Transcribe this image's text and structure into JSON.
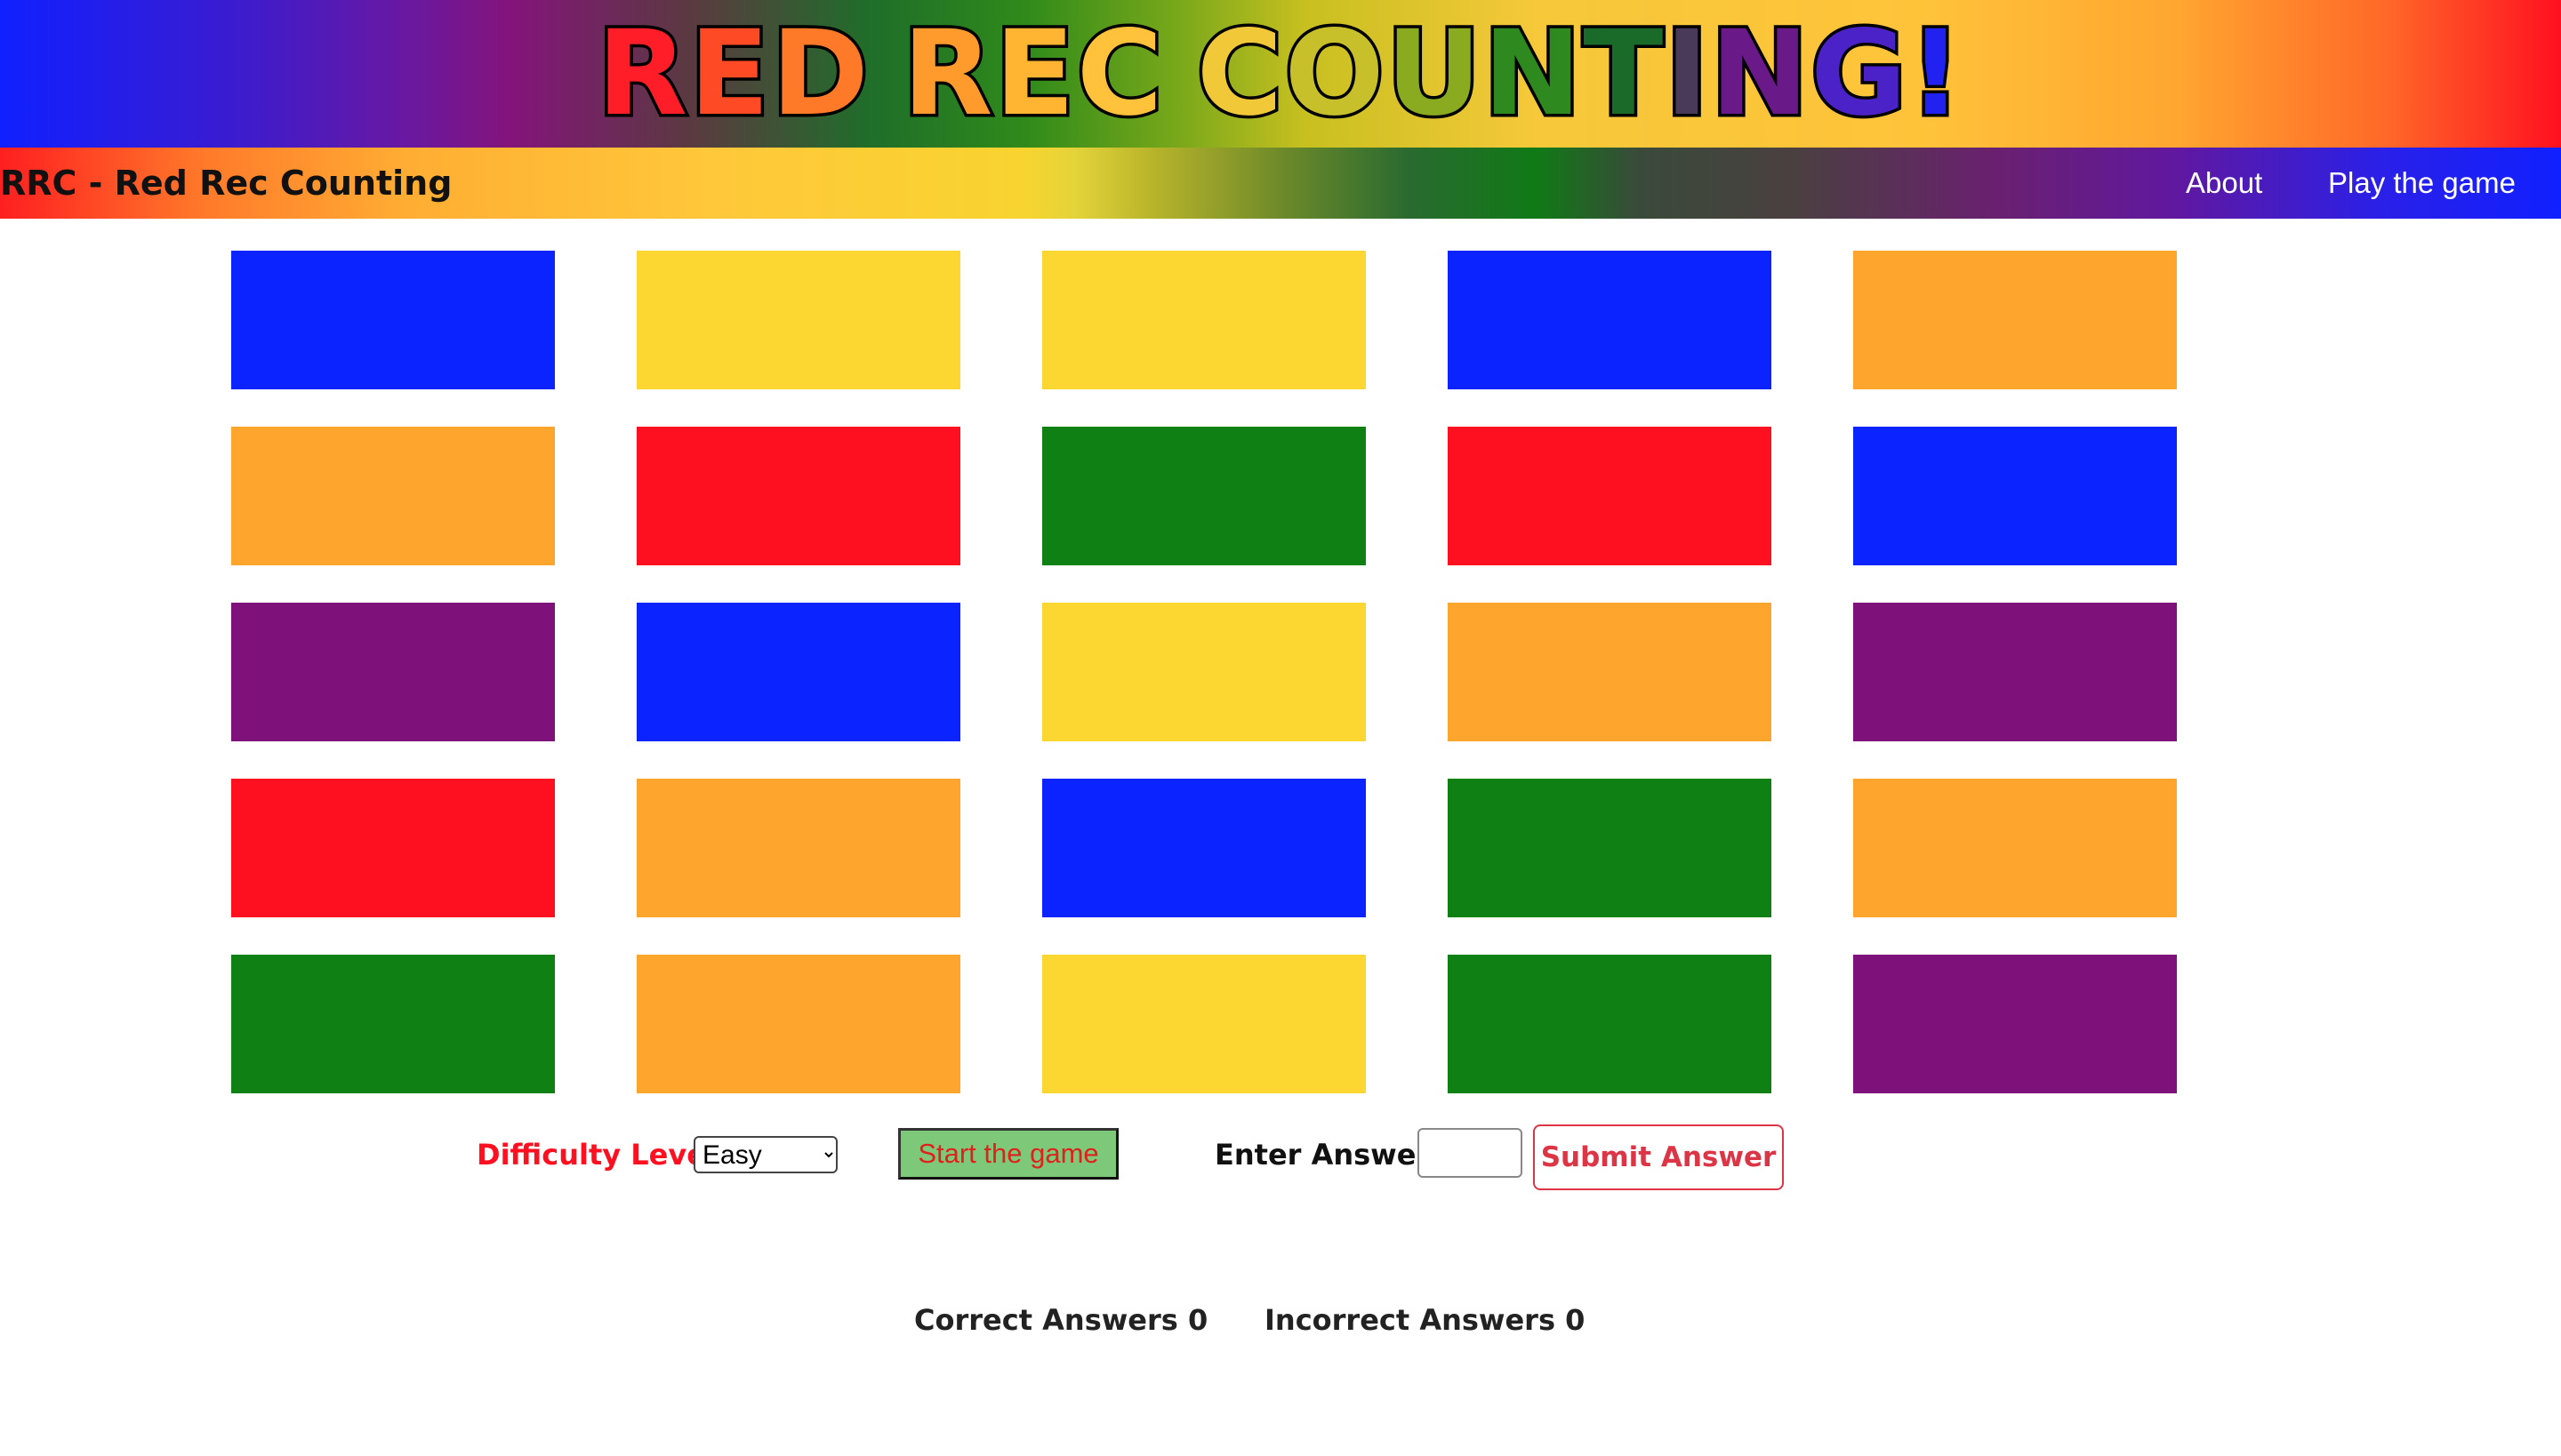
{
  "banner": {
    "title_letters": [
      "R",
      "E",
      "D",
      " ",
      "R",
      "E",
      "C",
      " ",
      "C",
      "O",
      "U",
      "N",
      "T",
      "I",
      "N",
      "G",
      "!"
    ],
    "title_colors": [
      "#ff1e28",
      "#ff4a26",
      "#ff7a28",
      "#ffffff",
      "#ff9a2c",
      "#ffb432",
      "#ffc23a",
      "#ffffff",
      "#f0c838",
      "#c8c02a",
      "#8aaa20",
      "#2e8a1e",
      "#1a6a2a",
      "#4a3a5a",
      "#6a1a88",
      "#4a22c8",
      "#2222f0"
    ]
  },
  "nav": {
    "brand": "RRC - Red Rec Counting",
    "links": [
      {
        "label": "About"
      },
      {
        "label": "Play the game"
      }
    ]
  },
  "colors": {
    "blue": "#0b24ff",
    "yellow": "#fcd631",
    "orange": "#fda52c",
    "red": "#ff1020",
    "green": "#0f8114",
    "purple": "#7f117b"
  },
  "tiles": [
    "blue",
    "yellow",
    "yellow",
    "blue",
    "orange",
    "orange",
    "red",
    "green",
    "red",
    "blue",
    "purple",
    "blue",
    "yellow",
    "orange",
    "purple",
    "red",
    "orange",
    "blue",
    "green",
    "orange",
    "green",
    "orange",
    "yellow",
    "green",
    "purple"
  ],
  "controls": {
    "difficulty_label": "Difficulty Level",
    "difficulty_value": "Easy",
    "start_label": "Start the game",
    "answer_label": "Enter Answer:",
    "answer_value": "",
    "submit_label": "Submit Answer"
  },
  "scores": {
    "correct": "Correct Answers 0",
    "incorrect": "Incorrect Answers 0"
  }
}
